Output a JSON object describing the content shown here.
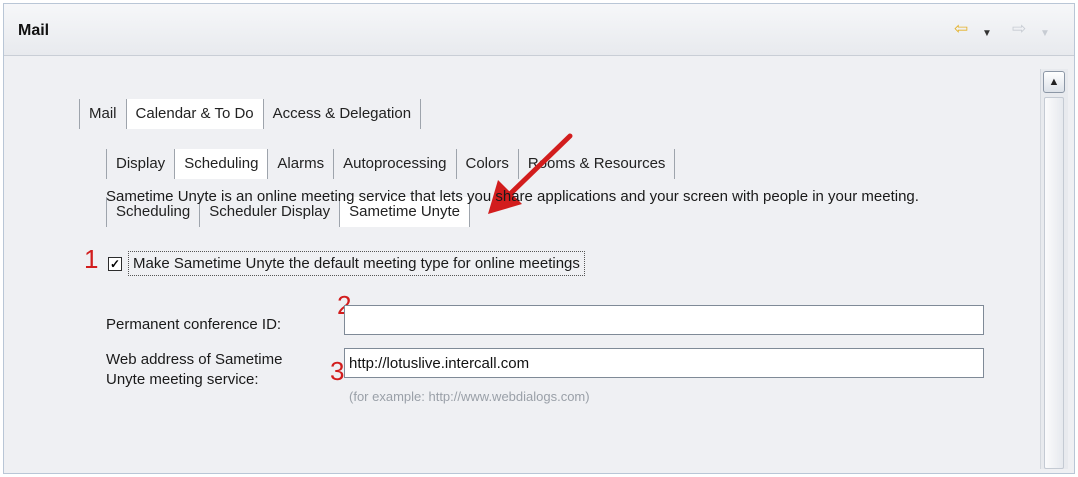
{
  "header": {
    "title": "Mail"
  },
  "tabs_level1": [
    "Mail",
    "Calendar & To Do",
    "Access & Delegation"
  ],
  "tabs_level2": [
    "Display",
    "Scheduling",
    "Alarms",
    "Autoprocessing",
    "Colors",
    "Rooms & Resources"
  ],
  "tabs_level3": [
    "Scheduling",
    "Scheduler Display",
    "Sametime Unyte"
  ],
  "description": "Sametime Unyte is an online meeting service that lets you share applications and your screen with people in your meeting.",
  "checkbox": {
    "label": "Make Sametime Unyte the default meeting type for online meetings",
    "checked": true
  },
  "conference_id": {
    "label": "Permanent conference ID:",
    "value": ""
  },
  "web_address": {
    "label_line1": "Web address of Sametime",
    "label_line2": "Unyte meeting service:",
    "value": "http://lotuslive.intercall.com",
    "hint": "(for example: http://www.webdialogs.com)"
  },
  "annotations": {
    "m1": "1",
    "m2": "2",
    "m3": "3"
  },
  "icons": {
    "back": "back-arrow-icon",
    "forward": "forward-arrow-icon"
  },
  "colors": {
    "accent": "#d21d1d",
    "back_arrow": "#e4b128"
  }
}
